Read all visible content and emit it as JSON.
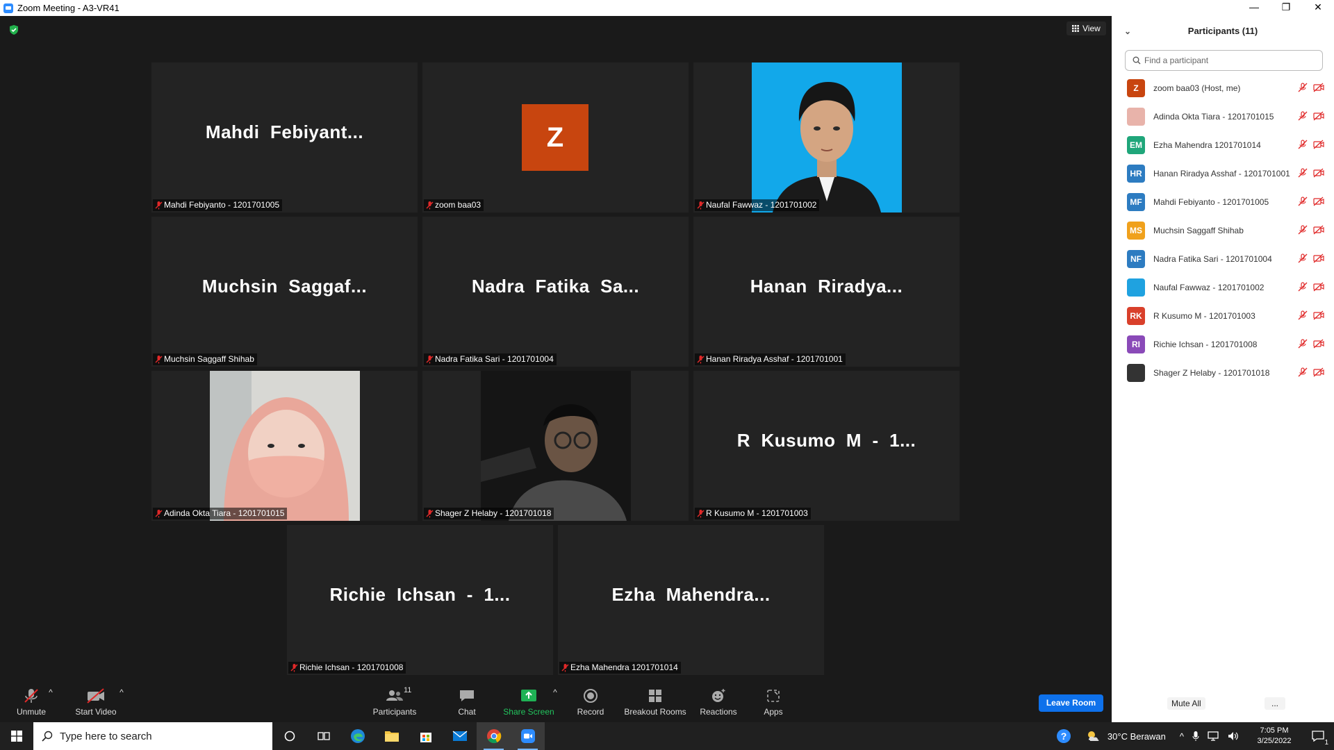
{
  "window": {
    "title": "Zoom Meeting - A3-VR41",
    "minimize": "—",
    "restore": "❐",
    "close": "✕"
  },
  "view_button": "View",
  "tiles": [
    {
      "big": "Mahdi  Febiyant...",
      "label": "Mahdi Febiyanto - 1201701005"
    },
    {
      "avatar_letter": "Z",
      "label": "zoom baa03"
    },
    {
      "label": "Naufal Fawwaz - 1201701002"
    },
    {
      "big": "Muchsin  Saggaf...",
      "label": "Muchsin Saggaff Shihab"
    },
    {
      "big": "Nadra  Fatika  Sa...",
      "label": "Nadra Fatika Sari - 1201701004"
    },
    {
      "big": "Hanan  Riradya...",
      "label": "Hanan Riradya Asshaf - 1201701001"
    },
    {
      "label": "Adinda Okta Tiara - 1201701015"
    },
    {
      "label": "Shager Z Helaby - 1201701018"
    },
    {
      "big": "R  Kusumo  M  -  1...",
      "label": "R Kusumo M - 1201701003"
    },
    {
      "big": "Richie  Ichsan  -  1...",
      "label": "Richie Ichsan - 1201701008"
    },
    {
      "big": "Ezha  Mahendra...",
      "label": "Ezha Mahendra 1201701014"
    }
  ],
  "toolbar": {
    "unmute": "Unmute",
    "start_video": "Start Video",
    "participants": "Participants",
    "participant_count": "11",
    "chat": "Chat",
    "share_screen": "Share Screen",
    "record": "Record",
    "breakout_rooms": "Breakout Rooms",
    "reactions": "Reactions",
    "apps": "Apps",
    "leave_room": "Leave Room"
  },
  "panel": {
    "title": "Participants (11)",
    "search_placeholder": "Find a participant",
    "participants": [
      {
        "initials": "Z",
        "name": "zoom baa03 (Host, me)",
        "color": "#c8450f"
      },
      {
        "initials": "",
        "name": "Adinda Okta Tiara - 1201701015",
        "color": "#e8b3aa"
      },
      {
        "initials": "EM",
        "name": "Ezha Mahendra 1201701014",
        "color": "#1fa67a"
      },
      {
        "initials": "HR",
        "name": "Hanan Riradya Asshaf - 1201701001",
        "color": "#2d7cc1"
      },
      {
        "initials": "MF",
        "name": "Mahdi Febiyanto - 1201701005",
        "color": "#2d7cc1"
      },
      {
        "initials": "MS",
        "name": "Muchsin Saggaff Shihab",
        "color": "#f0a11c"
      },
      {
        "initials": "NF",
        "name": "Nadra Fatika Sari - 1201701004",
        "color": "#2d7cc1"
      },
      {
        "initials": "",
        "name": "Naufal Fawwaz - 1201701002",
        "color": "#1fa2e0"
      },
      {
        "initials": "RK",
        "name": "R Kusumo M - 1201701003",
        "color": "#d9402b"
      },
      {
        "initials": "RI",
        "name": "Richie Ichsan - 1201701008",
        "color": "#8a4ab8"
      },
      {
        "initials": "",
        "name": "Shager Z Helaby - 1201701018",
        "color": "#333333"
      }
    ],
    "mute_all": "Mute All",
    "more": "..."
  },
  "taskbar": {
    "search_placeholder": "Type here to search",
    "weather": "30°C  Berawan",
    "time": "7:05 PM",
    "date": "3/25/2022",
    "notification_count": "1"
  }
}
